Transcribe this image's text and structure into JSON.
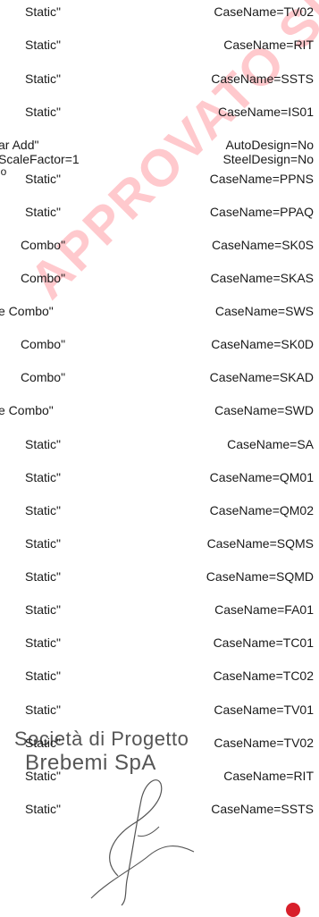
{
  "watermark": "APPROVATO SDP",
  "rows": [
    {
      "left": "Static\"",
      "right": "CaseName=TV02"
    },
    {
      "left": "Static\"",
      "right": "CaseName=RIT"
    },
    {
      "left": "Static\"",
      "right": "CaseName=SSTS"
    },
    {
      "left": "Static\"",
      "right": "CaseName=IS01"
    },
    {
      "left": "ar   Add\"",
      "right": "AutoDesign=No"
    },
    {
      "left": "ScaleFactor=1",
      "right": "SteelDesign=No"
    },
    {
      "left": "lo",
      "right": ""
    },
    {
      "left": "Static\"",
      "right": "CaseName=PPNS"
    },
    {
      "left": "Static\"",
      "right": "CaseName=PPAQ"
    },
    {
      "left": "Combo\"",
      "right": "CaseName=SK0S"
    },
    {
      "left": "Combo\"",
      "right": "CaseName=SKAS"
    },
    {
      "left": "e  Combo\"",
      "right": "CaseName=SWS"
    },
    {
      "left": "Combo\"",
      "right": "CaseName=SK0D"
    },
    {
      "left": "Combo\"",
      "right": "CaseName=SKAD"
    },
    {
      "left": "e  Combo\"",
      "right": "CaseName=SWD"
    },
    {
      "left": "Static\"",
      "right": "CaseName=SA"
    },
    {
      "left": "Static\"",
      "right": "CaseName=QM01"
    },
    {
      "left": "Static\"",
      "right": "CaseName=QM02"
    },
    {
      "left": "Static\"",
      "right": "CaseName=SQMS"
    },
    {
      "left": "Static\"",
      "right": "CaseName=SQMD"
    },
    {
      "left": "Static\"",
      "right": "CaseName=FA01"
    },
    {
      "left": "Static\"",
      "right": "CaseName=TC01"
    },
    {
      "left": "Static\"",
      "right": "CaseName=TC02"
    },
    {
      "left": "Static\"",
      "right": "CaseName=TV01"
    },
    {
      "left": "Static\"",
      "right": "CaseName=TV02"
    },
    {
      "left": "Static\"",
      "right": "CaseName=RIT"
    },
    {
      "left": "Static\"",
      "right": "CaseName=SSTS"
    }
  ],
  "stamp": {
    "line1": "Società di Progetto",
    "line2": "Brebemi SpA"
  },
  "colors": {
    "watermark": "#ffc0c5",
    "text": "#1a1a1a",
    "stamp": "#555555",
    "dot": "#d81f2a"
  }
}
